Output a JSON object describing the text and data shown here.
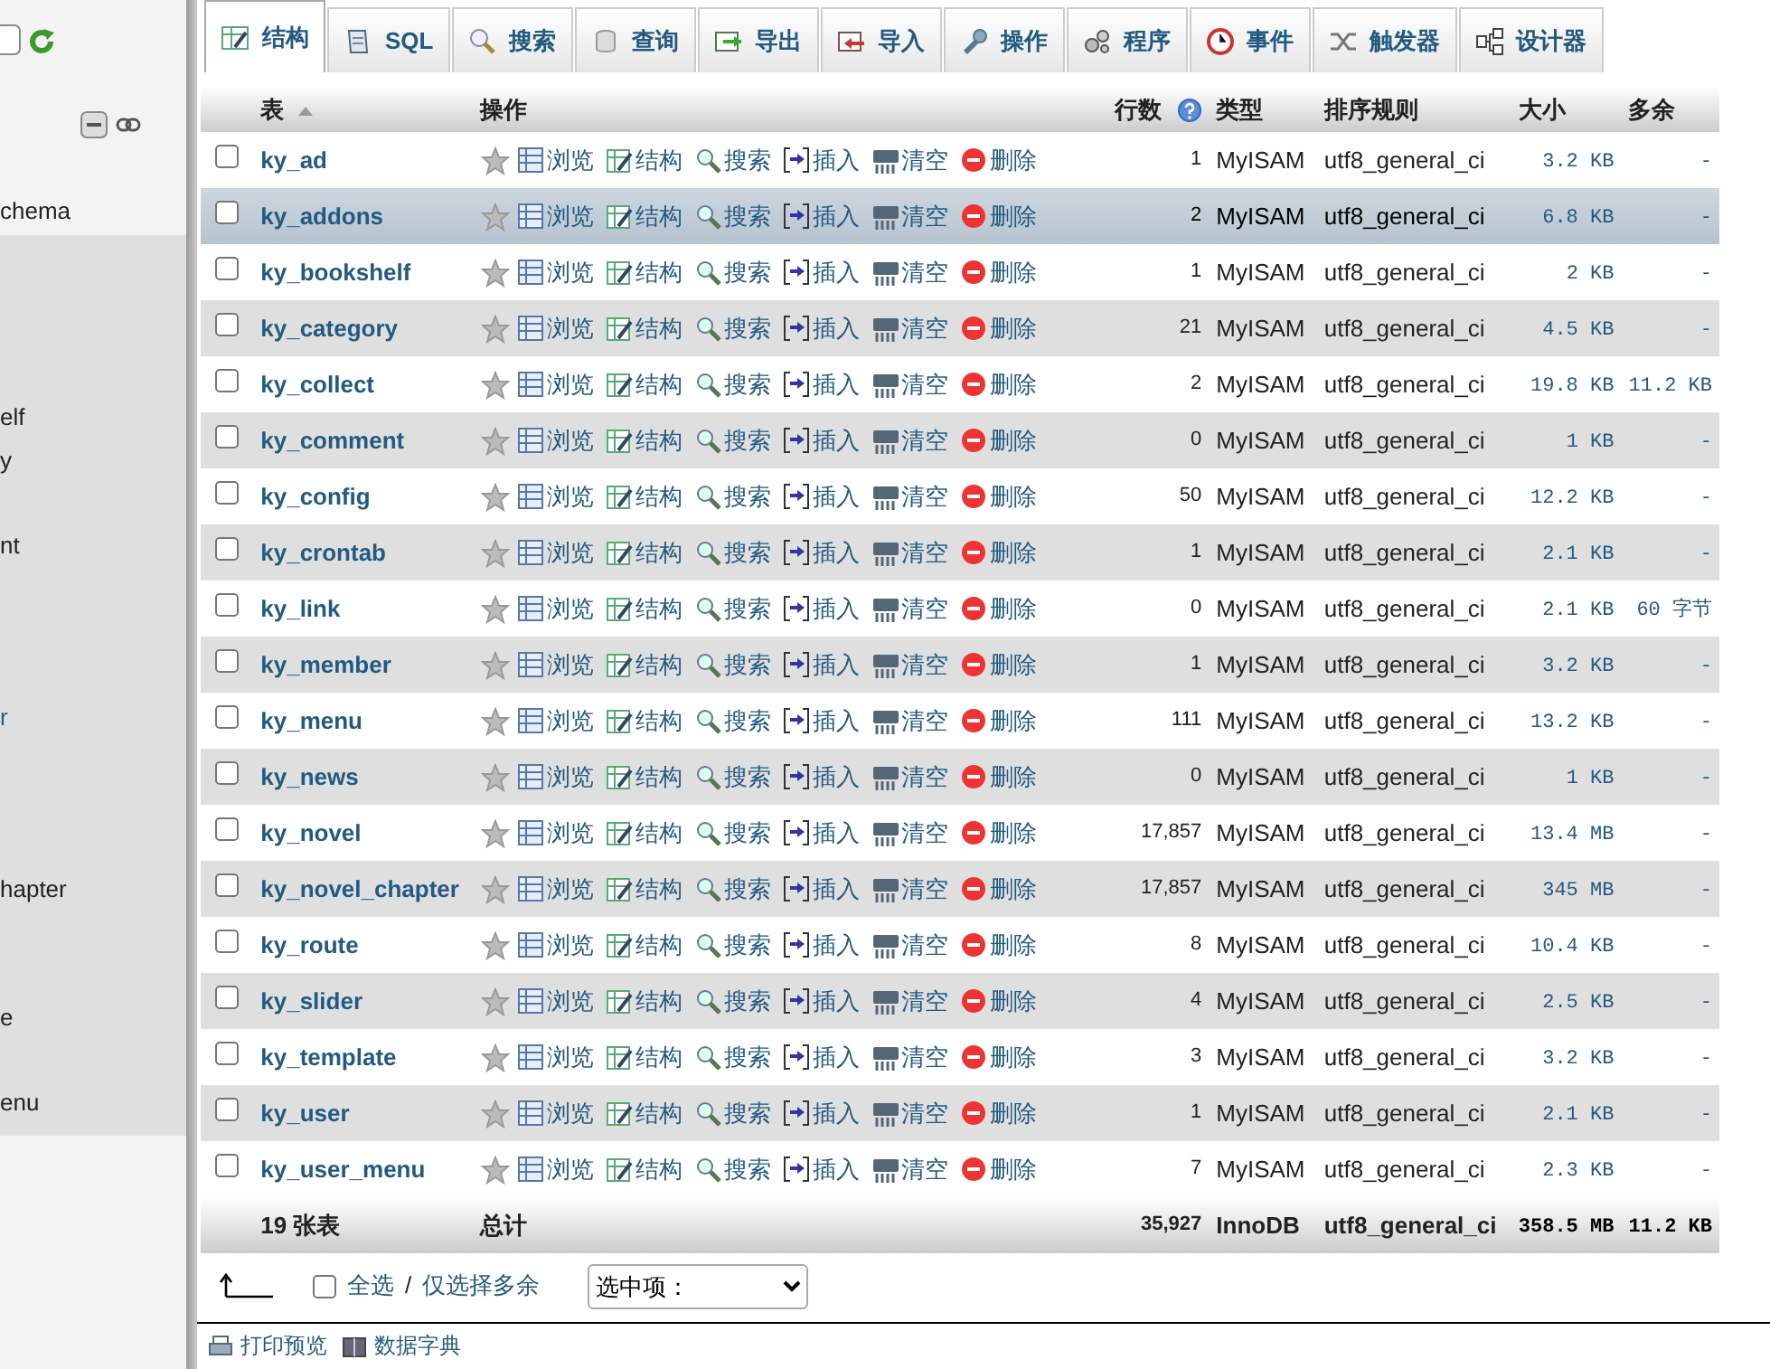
{
  "sidebar": {
    "database": "chema",
    "tables": [
      {
        "label": "elf",
        "highlighted": false
      },
      {
        "label": "y",
        "highlighted": false
      },
      {
        "label": "nt",
        "highlighted": false
      },
      {
        "label": "r",
        "highlighted": true
      },
      {
        "label": "hapter",
        "highlighted": false
      },
      {
        "label": "e",
        "highlighted": false
      },
      {
        "label": "enu",
        "highlighted": false
      }
    ]
  },
  "tabs": [
    {
      "label": "结构",
      "selected": true
    },
    {
      "label": "SQL",
      "selected": false
    },
    {
      "label": "搜索",
      "selected": false
    },
    {
      "label": "查询",
      "selected": false
    },
    {
      "label": "导出",
      "selected": false
    },
    {
      "label": "导入",
      "selected": false
    },
    {
      "label": "操作",
      "selected": false
    },
    {
      "label": "程序",
      "selected": false
    },
    {
      "label": "事件",
      "selected": false
    },
    {
      "label": "触发器",
      "selected": false
    },
    {
      "label": "设计器",
      "selected": false
    }
  ],
  "table": {
    "columns": [
      "表",
      "操作",
      "行数",
      "类型",
      "排序规则",
      "大小",
      "多余"
    ],
    "rows": [
      {
        "name": "ky_ad",
        "checked": false,
        "highlighted": false,
        "actions": [
          "浏览",
          "结构",
          "搜索",
          "插入",
          "清空",
          "删除"
        ],
        "row_count": "1",
        "type": "MyISAM",
        "collation": "utf8_general_ci",
        "size": "3.2 KB",
        "overhead": "-"
      },
      {
        "name": "ky_addons",
        "checked": false,
        "highlighted": true,
        "actions": [
          "浏览",
          "结构",
          "搜索",
          "插入",
          "清空",
          "删除"
        ],
        "row_count": "2",
        "type": "MyISAM",
        "collation": "utf8_general_ci",
        "size": "6.8 KB",
        "overhead": "-"
      },
      {
        "name": "ky_bookshelf",
        "checked": false,
        "highlighted": false,
        "actions": [
          "浏览",
          "结构",
          "搜索",
          "插入",
          "清空",
          "删除"
        ],
        "row_count": "1",
        "type": "MyISAM",
        "collation": "utf8_general_ci",
        "size": "2 KB",
        "overhead": "-"
      },
      {
        "name": "ky_category",
        "checked": false,
        "highlighted": false,
        "actions": [
          "浏览",
          "结构",
          "搜索",
          "插入",
          "清空",
          "删除"
        ],
        "row_count": "21",
        "type": "MyISAM",
        "collation": "utf8_general_ci",
        "size": "4.5 KB",
        "overhead": "-"
      },
      {
        "name": "ky_collect",
        "checked": false,
        "highlighted": false,
        "actions": [
          "浏览",
          "结构",
          "搜索",
          "插入",
          "清空",
          "删除"
        ],
        "row_count": "2",
        "type": "MyISAM",
        "collation": "utf8_general_ci",
        "size": "19.8 KB",
        "overhead": "11.2 KB"
      },
      {
        "name": "ky_comment",
        "checked": false,
        "highlighted": false,
        "actions": [
          "浏览",
          "结构",
          "搜索",
          "插入",
          "清空",
          "删除"
        ],
        "row_count": "0",
        "type": "MyISAM",
        "collation": "utf8_general_ci",
        "size": "1 KB",
        "overhead": "-"
      },
      {
        "name": "ky_config",
        "checked": false,
        "highlighted": false,
        "actions": [
          "浏览",
          "结构",
          "搜索",
          "插入",
          "清空",
          "删除"
        ],
        "row_count": "50",
        "type": "MyISAM",
        "collation": "utf8_general_ci",
        "size": "12.2 KB",
        "overhead": "-"
      },
      {
        "name": "ky_crontab",
        "checked": false,
        "highlighted": false,
        "actions": [
          "浏览",
          "结构",
          "搜索",
          "插入",
          "清空",
          "删除"
        ],
        "row_count": "1",
        "type": "MyISAM",
        "collation": "utf8_general_ci",
        "size": "2.1 KB",
        "overhead": "-"
      },
      {
        "name": "ky_link",
        "checked": false,
        "highlighted": false,
        "actions": [
          "浏览",
          "结构",
          "搜索",
          "插入",
          "清空",
          "删除"
        ],
        "row_count": "0",
        "type": "MyISAM",
        "collation": "utf8_general_ci",
        "size": "2.1 KB",
        "overhead": "60 字节"
      },
      {
        "name": "ky_member",
        "checked": false,
        "highlighted": false,
        "actions": [
          "浏览",
          "结构",
          "搜索",
          "插入",
          "清空",
          "删除"
        ],
        "row_count": "1",
        "type": "MyISAM",
        "collation": "utf8_general_ci",
        "size": "3.2 KB",
        "overhead": "-"
      },
      {
        "name": "ky_menu",
        "checked": false,
        "highlighted": false,
        "actions": [
          "浏览",
          "结构",
          "搜索",
          "插入",
          "清空",
          "删除"
        ],
        "row_count": "111",
        "type": "MyISAM",
        "collation": "utf8_general_ci",
        "size": "13.2 KB",
        "overhead": "-"
      },
      {
        "name": "ky_news",
        "checked": false,
        "highlighted": false,
        "actions": [
          "浏览",
          "结构",
          "搜索",
          "插入",
          "清空",
          "删除"
        ],
        "row_count": "0",
        "type": "MyISAM",
        "collation": "utf8_general_ci",
        "size": "1 KB",
        "overhead": "-"
      },
      {
        "name": "ky_novel",
        "checked": false,
        "highlighted": false,
        "actions": [
          "浏览",
          "结构",
          "搜索",
          "插入",
          "清空",
          "删除"
        ],
        "row_count": "17,857",
        "type": "MyISAM",
        "collation": "utf8_general_ci",
        "size": "13.4 MB",
        "overhead": "-"
      },
      {
        "name": "ky_novel_chapter",
        "checked": false,
        "highlighted": false,
        "actions": [
          "浏览",
          "结构",
          "搜索",
          "插入",
          "清空",
          "删除"
        ],
        "row_count": "17,857",
        "type": "MyISAM",
        "collation": "utf8_general_ci",
        "size": "345 MB",
        "overhead": "-"
      },
      {
        "name": "ky_route",
        "checked": false,
        "highlighted": false,
        "actions": [
          "浏览",
          "结构",
          "搜索",
          "插入",
          "清空",
          "删除"
        ],
        "row_count": "8",
        "type": "MyISAM",
        "collation": "utf8_general_ci",
        "size": "10.4 KB",
        "overhead": "-"
      },
      {
        "name": "ky_slider",
        "checked": false,
        "highlighted": false,
        "actions": [
          "浏览",
          "结构",
          "搜索",
          "插入",
          "清空",
          "删除"
        ],
        "row_count": "4",
        "type": "MyISAM",
        "collation": "utf8_general_ci",
        "size": "2.5 KB",
        "overhead": "-"
      },
      {
        "name": "ky_template",
        "checked": false,
        "highlighted": false,
        "actions": [
          "浏览",
          "结构",
          "搜索",
          "插入",
          "清空",
          "删除"
        ],
        "row_count": "3",
        "type": "MyISAM",
        "collation": "utf8_general_ci",
        "size": "3.2 KB",
        "overhead": "-"
      },
      {
        "name": "ky_user",
        "checked": false,
        "highlighted": false,
        "actions": [
          "浏览",
          "结构",
          "搜索",
          "插入",
          "清空",
          "删除"
        ],
        "row_count": "1",
        "type": "MyISAM",
        "collation": "utf8_general_ci",
        "size": "2.1 KB",
        "overhead": "-"
      },
      {
        "name": "ky_user_menu",
        "checked": false,
        "highlighted": false,
        "actions": [
          "浏览",
          "结构",
          "搜索",
          "插入",
          "清空",
          "删除"
        ],
        "row_count": "7",
        "type": "MyISAM",
        "collation": "utf8_general_ci",
        "size": "2.3 KB",
        "overhead": "-"
      }
    ],
    "summary": {
      "count": "19 张表",
      "label": "总计",
      "row_count": "35,927",
      "type": "InnoDB",
      "collation": "utf8_general_ci",
      "size": "358.5 MB",
      "overhead": "11.2 KB"
    }
  },
  "bulk_actions": {
    "checked": false,
    "check_all": "全选",
    "separator": "/",
    "check_overhead": "仅选择多余",
    "select_placeholder": "选中项："
  },
  "footer_links": [
    "打印预览",
    "数据字典"
  ]
}
